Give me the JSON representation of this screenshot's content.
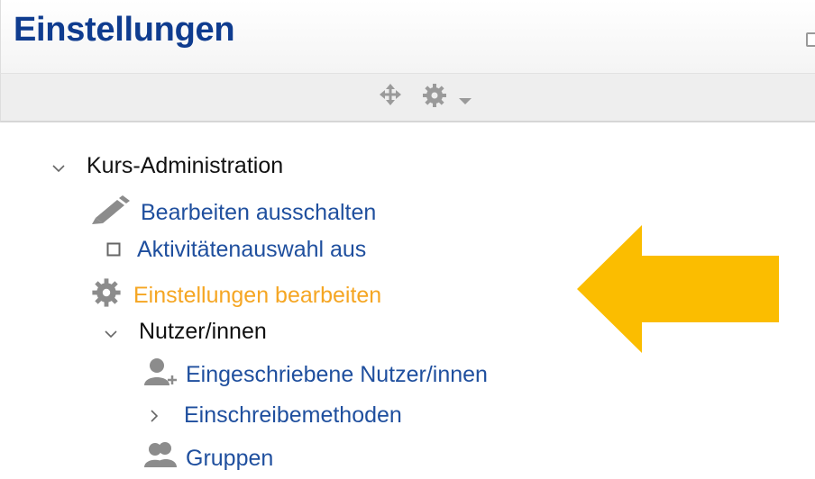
{
  "block": {
    "title": "Einstellungen"
  },
  "controls": {
    "move_icon": "move-icon",
    "gear_icon": "gear-icon",
    "caret_icon": "caret-down-icon"
  },
  "tree": {
    "course_admin_label": "Kurs-Administration",
    "edit_off_label": "Bearbeiten ausschalten",
    "activity_chooser_label": "Aktivitätenauswahl aus",
    "edit_settings_label": "Einstellungen bearbeiten",
    "users_label": "Nutzer/innen",
    "enrolled_users_label": "Eingeschriebene Nutzer/innen",
    "enrolment_methods_label": "Einschreibemethoden",
    "groups_label": "Gruppen"
  },
  "colors": {
    "title": "#0f3c8f",
    "link": "#1f4f9e",
    "active": "#f5a623",
    "arrow": "#fbbd00",
    "icon": "#9a9a9a"
  }
}
